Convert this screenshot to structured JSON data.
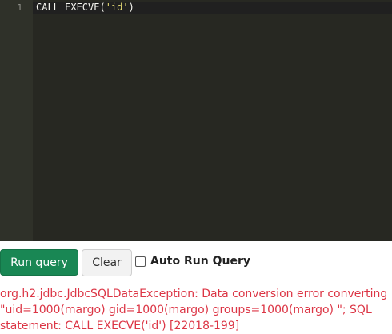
{
  "editor": {
    "line_number": "1",
    "code_prefix": "CALL EXECVE(",
    "code_string": "'id'",
    "code_suffix": ")"
  },
  "toolbar": {
    "run_label": "Run query",
    "clear_label": "Clear",
    "auto_run_label": "Auto Run Query",
    "auto_run_checked": false
  },
  "error": {
    "lines": [
      "org.h2.jdbc.JdbcSQLDataException: Data conversion error converting",
      "\"uid=1000(margo) gid=1000(margo) groups=1000(margo) \"; SQL",
      "statement: CALL EXECVE('id') [22018-199]"
    ]
  },
  "colors": {
    "editor_bg": "#272822",
    "run_button": "#198754",
    "error_text": "#dc3545"
  }
}
